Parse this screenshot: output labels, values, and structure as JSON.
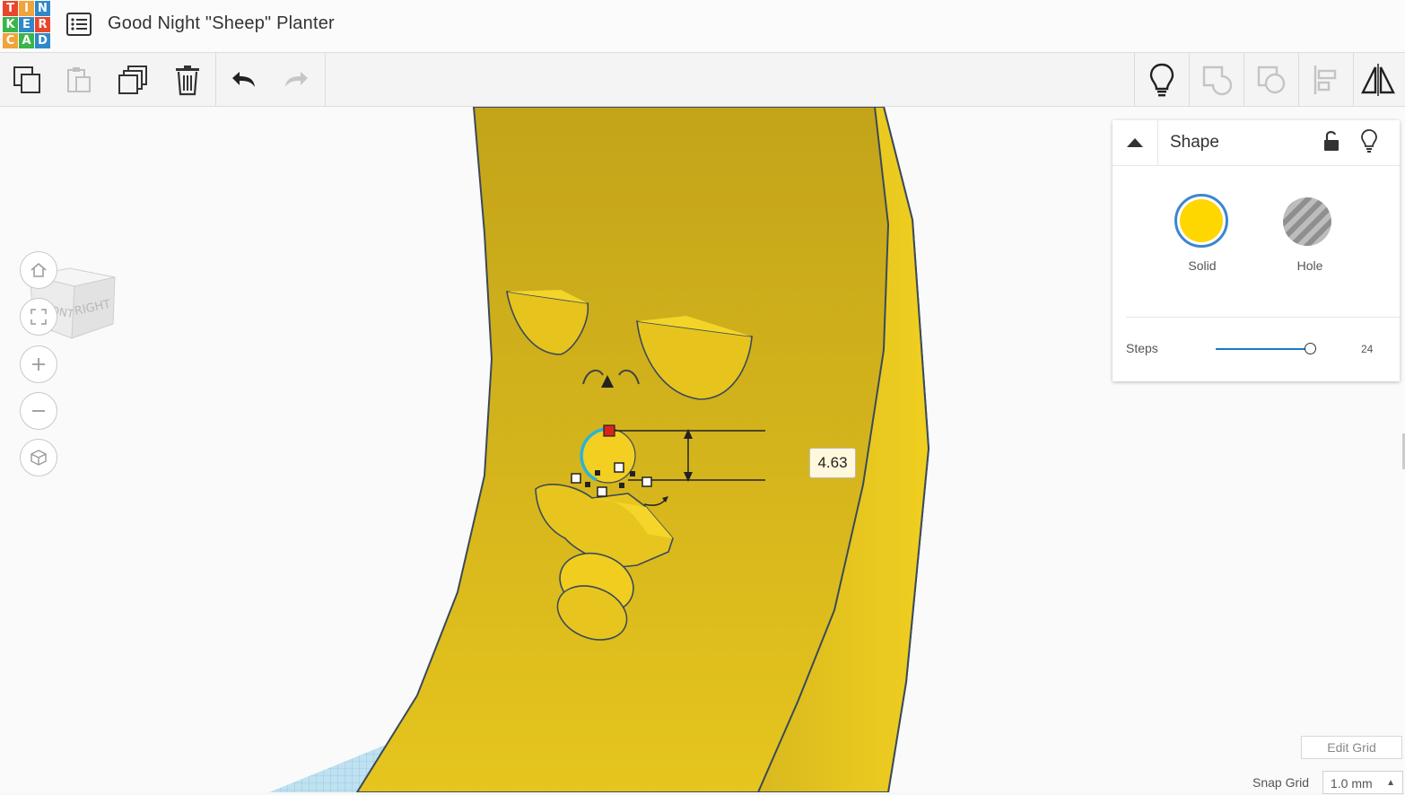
{
  "app": {
    "logo_letters": [
      "T",
      "I",
      "N",
      "K",
      "E",
      "R",
      "C",
      "A",
      "D"
    ],
    "logo_colors": [
      "#e9462d",
      "#f2a33c",
      "#2e89c9",
      "#39b54a",
      "#2e89c9",
      "#e9462d",
      "#f2a33c",
      "#39b54a",
      "#2e89c9"
    ],
    "design_title": "Good Night \"Sheep\" Planter"
  },
  "toolbar": {
    "left": [
      {
        "name": "copy-icon",
        "enabled": true
      },
      {
        "name": "paste-icon",
        "enabled": false
      },
      {
        "name": "duplicate-icon",
        "enabled": true
      },
      {
        "name": "delete-icon",
        "enabled": true
      },
      {
        "name": "undo-icon",
        "enabled": true
      },
      {
        "name": "redo-icon",
        "enabled": false
      }
    ],
    "right": [
      {
        "name": "note-bulb-icon",
        "enabled": true
      },
      {
        "name": "group-icon",
        "enabled": false
      },
      {
        "name": "ungroup-icon",
        "enabled": false
      },
      {
        "name": "align-icon",
        "enabled": false
      },
      {
        "name": "mirror-icon",
        "enabled": true
      }
    ]
  },
  "viewcube": {
    "front": "FRONT",
    "right": "RIGHT"
  },
  "nav": [
    "home-view-icon",
    "fit-view-icon",
    "zoom-in-icon",
    "zoom-out-icon",
    "perspective-icon"
  ],
  "panel": {
    "title": "Shape",
    "solid_label": "Solid",
    "hole_label": "Hole",
    "solid_color": "#ffd700",
    "steps_label": "Steps",
    "steps_value": "24"
  },
  "measurement": "4.63",
  "grid": {
    "edit_label": "Edit Grid",
    "snap_label": "Snap Grid",
    "snap_value": "1.0 mm"
  }
}
